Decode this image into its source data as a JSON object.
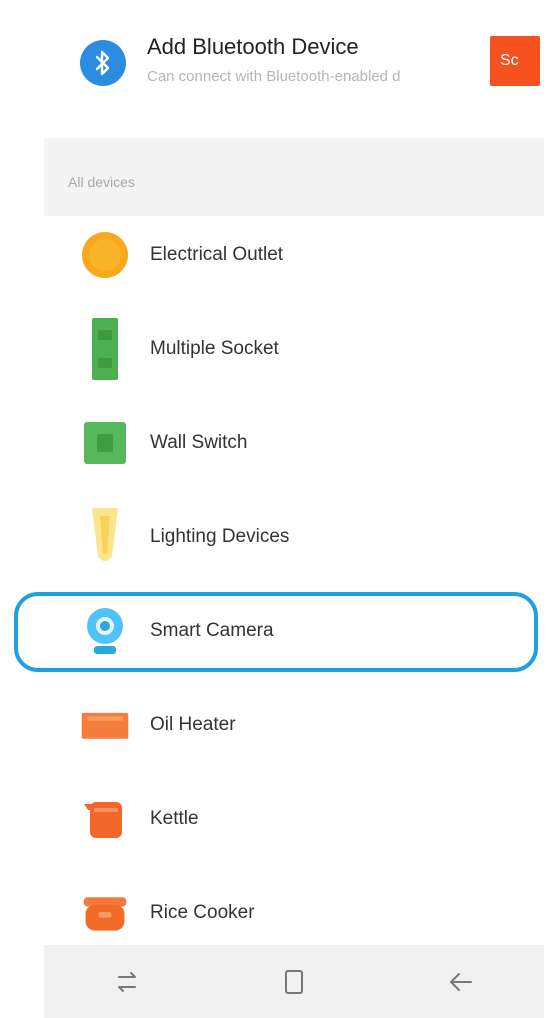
{
  "bluetooth": {
    "title": "Add Bluetooth Device",
    "subtitle": "Can connect with Bluetooth-enabled d",
    "scan_label": "Sc",
    "icon": "bluetooth-icon",
    "accent": "#2b8ce0",
    "button_color": "#f4511e"
  },
  "section": {
    "label": "All devices"
  },
  "devices": [
    {
      "label": "Electrical Outlet",
      "icon": "electrical-outlet-icon"
    },
    {
      "label": "Multiple Socket",
      "icon": "multiple-socket-icon"
    },
    {
      "label": "Wall Switch",
      "icon": "wall-switch-icon"
    },
    {
      "label": "Lighting Devices",
      "icon": "lighting-devices-icon"
    },
    {
      "label": "Smart Camera",
      "icon": "smart-camera-icon",
      "highlighted": true
    },
    {
      "label": "Oil Heater",
      "icon": "oil-heater-icon"
    },
    {
      "label": "Kettle",
      "icon": "kettle-icon"
    },
    {
      "label": "Rice Cooker",
      "icon": "rice-cooker-icon"
    }
  ],
  "highlight_color": "#1fa0e0",
  "navbar": {
    "icons": [
      "recent-apps-icon",
      "home-icon",
      "back-icon"
    ]
  }
}
